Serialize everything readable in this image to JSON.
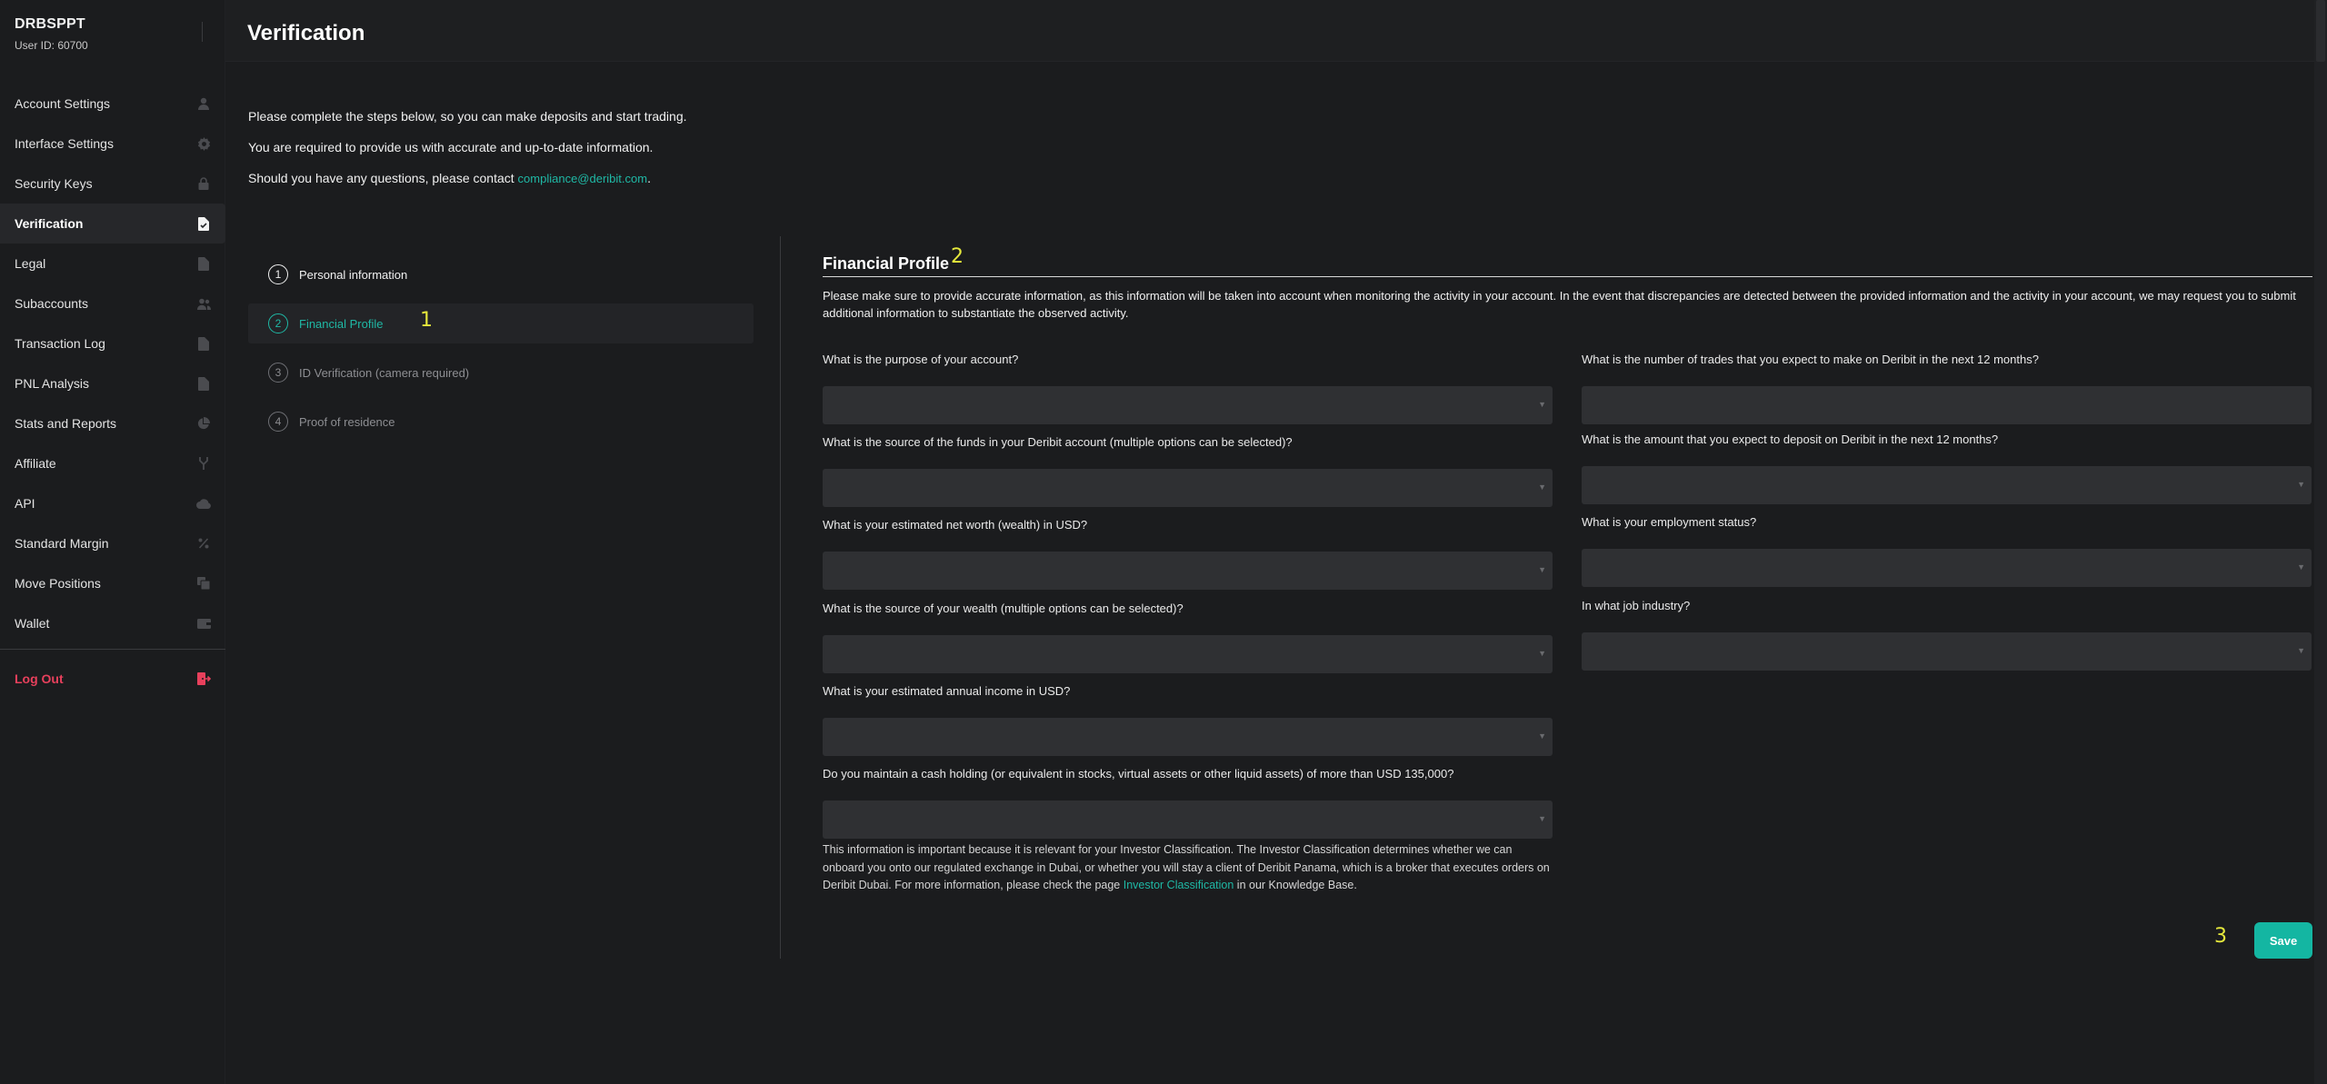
{
  "user": {
    "name": "DRBSPPT",
    "id_label": "User ID: 60700"
  },
  "sidebar": {
    "items": [
      {
        "label": "Account Settings",
        "icon": "user-icon"
      },
      {
        "label": "Interface Settings",
        "icon": "gear-icon"
      },
      {
        "label": "Security Keys",
        "icon": "lock-icon"
      },
      {
        "label": "Verification",
        "icon": "document-check-icon",
        "active": true
      },
      {
        "label": "Legal",
        "icon": "document-icon"
      },
      {
        "label": "Subaccounts",
        "icon": "users-icon"
      },
      {
        "label": "Transaction Log",
        "icon": "document-icon"
      },
      {
        "label": "PNL Analysis",
        "icon": "document-icon"
      },
      {
        "label": "Stats and Reports",
        "icon": "pie-chart-icon"
      },
      {
        "label": "Affiliate",
        "icon": "fork-icon"
      },
      {
        "label": "API",
        "icon": "cloud-icon"
      },
      {
        "label": "Standard Margin",
        "icon": "percent-icon"
      },
      {
        "label": "Move Positions",
        "icon": "copy-icon"
      },
      {
        "label": "Wallet",
        "icon": "wallet-icon"
      }
    ],
    "logout_label": "Log Out"
  },
  "header": {
    "title": "Verification"
  },
  "intro": {
    "line1": "Please complete the steps below, so you can make deposits and start trading.",
    "line2": "You are required to provide us with accurate and up-to-date information.",
    "line3_prefix": "Should you have any questions, please contact ",
    "line3_link": "compliance@deribit.com",
    "line3_suffix": "."
  },
  "steps": [
    {
      "num": "1",
      "label": "Personal information",
      "state": "done"
    },
    {
      "num": "2",
      "label": "Financial Profile",
      "state": "active"
    },
    {
      "num": "3",
      "label": "ID Verification (camera required)",
      "state": "pending"
    },
    {
      "num": "4",
      "label": "Proof of residence",
      "state": "pending"
    }
  ],
  "markers": {
    "m1": "1",
    "m2": "2",
    "m3": "3"
  },
  "form": {
    "title": "Financial Profile",
    "description": "Please make sure to provide accurate information, as this information will be taken into account when monitoring the activity in your account. In the event that discrepancies are detected between the provided information and the activity in your account, we may request you to submit additional information to substantiate the observed activity.",
    "left_questions": [
      "What is the purpose of your account?",
      "What is the source of the funds in your Deribit account (multiple options can be selected)?",
      "What is your estimated net worth (wealth) in USD?",
      "What is the source of your wealth (multiple options can be selected)?",
      "What is your estimated annual income in USD?",
      "Do you maintain a cash holding (or equivalent in stocks, virtual assets or other liquid assets) of more than USD 135,000?"
    ],
    "right_questions": [
      "What is the number of trades that you expect to make on Deribit in the next 12 months?",
      "What is the amount that you expect to deposit on Deribit in the next 12 months?",
      "What is your employment status?",
      "In what job industry?"
    ],
    "footnote_prefix": "This information is important because it is relevant for your Investor Classification. The Investor Classification determines whether we can onboard you onto our regulated exchange in Dubai, or whether you will stay a client of Deribit Panama, which is a broker that executes orders on Deribit Dubai. For more information, please check the page ",
    "footnote_link": "Investor Classification",
    "footnote_suffix": " in our Knowledge Base.",
    "save_label": "Save"
  },
  "colors": {
    "accent": "#14b6a2",
    "logout": "#e8405c",
    "marker": "#e5e83c",
    "background": "#1b1c1e"
  }
}
